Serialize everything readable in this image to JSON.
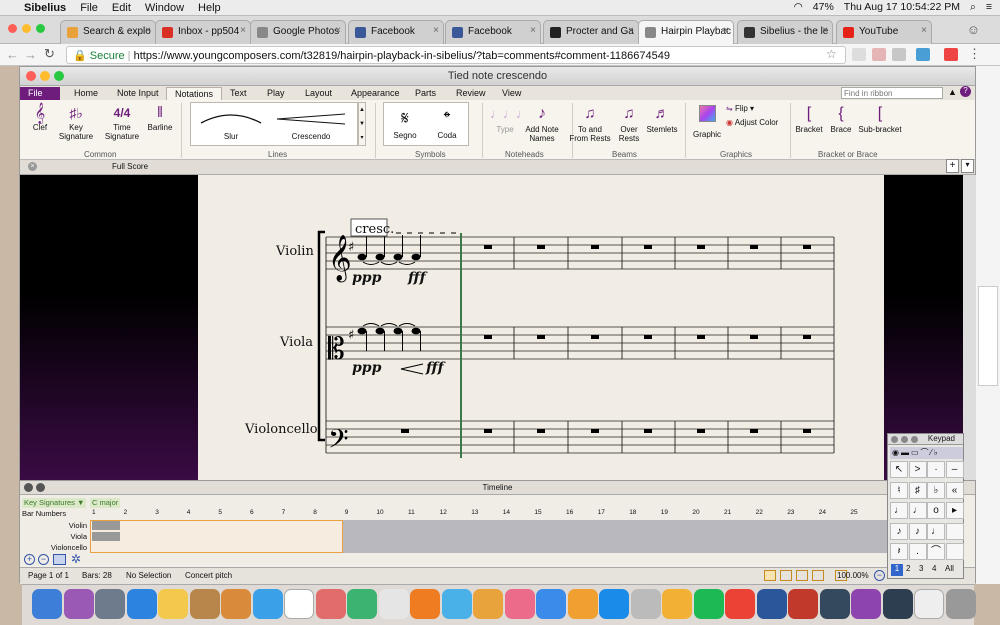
{
  "menubar": {
    "apple": "",
    "app": "Sibelius",
    "items": [
      "File",
      "Edit",
      "Window",
      "Help"
    ],
    "battery": "47%",
    "datetime": "Thu Aug 17  10:54:22 PM"
  },
  "browser": {
    "tabs": [
      {
        "label": "Search & explo",
        "color": "#e9a13b"
      },
      {
        "label": "Inbox - pp504",
        "color": "#d93025"
      },
      {
        "label": "Google Photos",
        "color": "#888"
      },
      {
        "label": "Facebook",
        "color": "#3b5998"
      },
      {
        "label": "Facebook",
        "color": "#3b5998"
      },
      {
        "label": "Procter and Ga",
        "color": "#222"
      },
      {
        "label": "Hairpin Playbac",
        "color": "#888"
      },
      {
        "label": "Sibelius - the le",
        "color": "#333"
      },
      {
        "label": "YouTube",
        "color": "#e62117"
      }
    ],
    "secure": "Secure",
    "url": "https://www.youngcomposers.com/t32819/hairpin-playback-in-sibelius/?tab=comments#comment-1186674549"
  },
  "sibelius": {
    "title": "Tied note crescendo",
    "ribbon_tabs": [
      "File",
      "Home",
      "Note Input",
      "Notations",
      "Text",
      "Play",
      "Layout",
      "Appearance",
      "Parts",
      "Review",
      "View"
    ],
    "search_placeholder": "Find in ribbon",
    "buttons": {
      "clef": "Clef",
      "key_sig": "Key\nSignature",
      "time_sig": "Time\nSignature",
      "barline": "Barline",
      "slur": "Slur",
      "crescendo": "Crescendo",
      "segno": "Segno",
      "coda": "Coda",
      "type": "Type",
      "add_note_names": "Add Note\nNames",
      "to_from_rests": "To and\nFrom Rests",
      "over_rests": "Over\nRests",
      "stemlets": "Stemlets",
      "graphic": "Graphic",
      "flip": "Flip",
      "adjust_color": "Adjust Color",
      "bracket": "Bracket",
      "brace": "Brace",
      "subbracket": "Sub-bracket"
    },
    "groups": [
      "Common",
      "Lines",
      "Symbols",
      "Noteheads",
      "Beams",
      "Graphics",
      "Bracket or Brace"
    ],
    "score_tab": "Full Score",
    "staves": [
      "Violin",
      "Viola",
      "Violoncello"
    ],
    "text_marks": {
      "cresc": "cresc.",
      "ppp": "ppp",
      "fff": "fff"
    },
    "timeline": {
      "title": "Timeline",
      "rows": [
        "Key Signatures",
        "Bar Numbers",
        "Violin",
        "Viola",
        "Violoncello"
      ],
      "key": "C major",
      "bars": [
        "1",
        "2",
        "3",
        "4",
        "5",
        "6",
        "7",
        "8",
        "9",
        "10",
        "11",
        "12",
        "13",
        "14",
        "15",
        "16",
        "17",
        "18",
        "19",
        "20",
        "21",
        "22",
        "23",
        "24",
        "25"
      ]
    },
    "status": {
      "page": "Page 1 of 1",
      "bars": "Bars: 28",
      "selection": "No Selection",
      "pitch": "Concert pitch",
      "zoom": "100.00%"
    },
    "keypad": {
      "title": "Keypad",
      "tabs": [
        "1",
        "2",
        "3",
        "4",
        "All"
      ]
    }
  }
}
